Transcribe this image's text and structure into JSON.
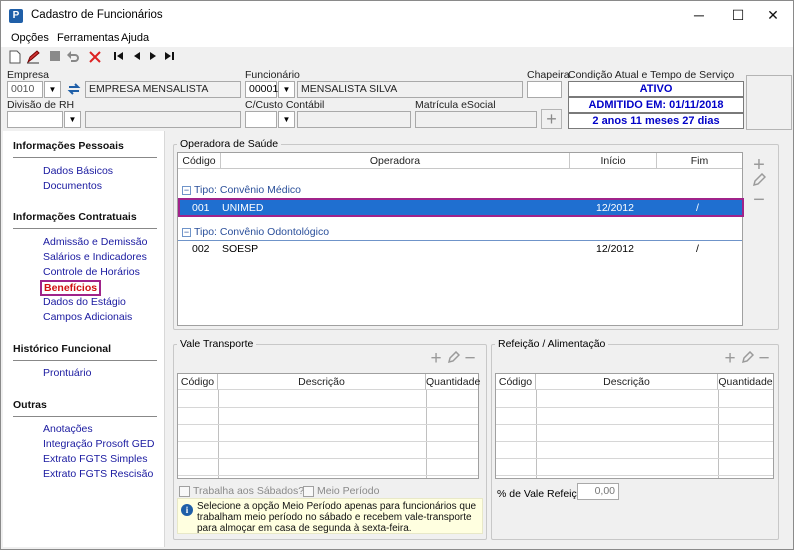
{
  "window": {
    "title": "Cadastro de Funcionários",
    "app_icon": "P",
    "minimize": "─",
    "maximize": "☐",
    "close": "✕"
  },
  "menu": {
    "items": [
      "Opções",
      "Ferramentas",
      "Ajuda"
    ]
  },
  "toolbar": {
    "icons": [
      "new-document-icon",
      "edit-icon",
      "stop-icon",
      "undo-icon",
      "delete-icon",
      "first-icon",
      "previous-icon",
      "next-icon",
      "last-icon"
    ]
  },
  "header": {
    "empresa_label": "Empresa",
    "empresa_code": "0010",
    "empresa_name": "EMPRESA MENSALISTA",
    "funcionario_label": "Funcionário",
    "funcionario_code": "00001",
    "funcionario_name": "MENSALISTA SILVA",
    "chapeira_label": "Chapeira",
    "chapeira_value": "",
    "condicao_label": "Condição Atual e Tempo de Serviço",
    "status": "ATIVO",
    "admitido": "ADMITIDO EM: 01/11/2018",
    "tempo": "2 anos 11 meses 27 dias",
    "divisao_label": "Divisão de RH",
    "divisao_value": "",
    "custo_label": "C/Custo Contábil",
    "custo_value": "",
    "matricula_label": "Matrícula eSocial",
    "matricula_value": ""
  },
  "sidebar": {
    "sections": [
      {
        "title": "Informações Pessoais",
        "items": [
          "Dados Básicos",
          "Documentos"
        ]
      },
      {
        "title": "Informações Contratuais",
        "items": [
          "Admissão e Demissão",
          "Salários e Indicadores",
          "Controle de Horários",
          "Benefícios",
          "Dados do Estágio",
          "Campos Adicionais"
        ]
      },
      {
        "title": "Histórico Funcional",
        "items": [
          "Prontuário"
        ]
      },
      {
        "title": "Outras",
        "items": [
          "Anotações",
          "Integração Prosoft GED",
          "Extrato FGTS Simples",
          "Extrato FGTS Rescisão"
        ]
      }
    ],
    "active_item": "Benefícios"
  },
  "operadora": {
    "title": "Operadora de Saúde",
    "columns": [
      "Código",
      "Operadora",
      "Início",
      "Fim"
    ],
    "groups": [
      {
        "label": "Tipo: Convênio Médico",
        "rows": [
          {
            "codigo": "001",
            "operadora": "UNIMED",
            "inicio": "12/2012",
            "fim": "/"
          }
        ]
      },
      {
        "label": "Tipo: Convênio Odontológico",
        "rows": [
          {
            "codigo": "002",
            "operadora": "SOESP",
            "inicio": "12/2012",
            "fim": "/"
          }
        ]
      }
    ]
  },
  "vale": {
    "title": "Vale Transporte",
    "columns": [
      "Código",
      "Descrição",
      "Quantidade"
    ],
    "trabalha_sabados": "Trabalha aos Sábados?",
    "meio_periodo": "Meio Período",
    "info": "Selecione a opção Meio Período apenas para funcionários que trabalham meio período no sábado e recebem vale-transporte para almoçar em casa de segunda à sexta-feira."
  },
  "refeicao": {
    "title": "Refeição / Alimentação",
    "columns": [
      "Código",
      "Descrição",
      "Quantidade"
    ],
    "percent_label": "% de Vale Refeição",
    "percent_value": "0,00"
  }
}
